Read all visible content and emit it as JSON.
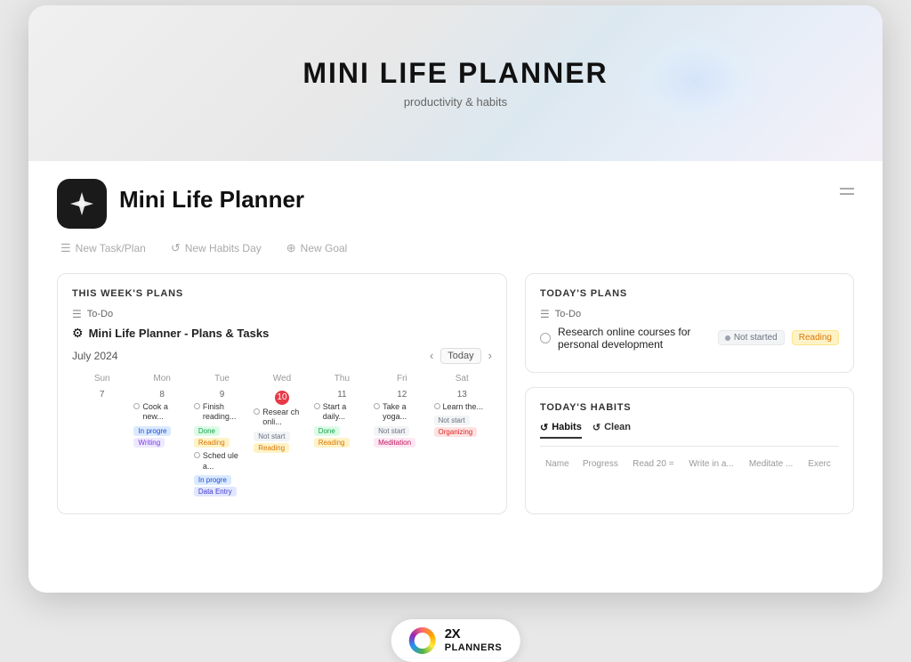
{
  "app": {
    "title": "MINI LIFE PLANNER",
    "subtitle": "productivity & habits",
    "page_name": "Mini Life Planner"
  },
  "actions": [
    {
      "id": "new-task",
      "label": "New Task/Plan",
      "icon": "☰"
    },
    {
      "id": "new-habits",
      "label": "New Habits Day",
      "icon": "↺"
    },
    {
      "id": "new-goal",
      "label": "New Goal",
      "icon": "⊕"
    }
  ],
  "this_weeks_plans": {
    "title": "THIS WEEK'S PLANS",
    "todo_label": "To-Do",
    "planner_icon": "⚙",
    "planner_name": "Mini Life Planner - Plans & Tasks",
    "calendar_month": "July 2024",
    "today_label": "Today",
    "days_of_week": [
      "Sun",
      "Mon",
      "Tue",
      "Wed",
      "Thu",
      "Fri",
      "Sat"
    ],
    "week_dates": [
      7,
      8,
      9,
      10,
      11,
      12,
      13
    ],
    "today_date": 10,
    "tasks": {
      "7": [],
      "8": [
        {
          "text": "Cook a new...",
          "tag": "In progress",
          "tag_class": "tag-in-progress"
        },
        {
          "tag2": "Writing",
          "tag2_class": "tag-writing"
        }
      ],
      "9": [
        {
          "text": "Finish reading...",
          "tag": "Done",
          "tag_class": "tag-done"
        },
        {
          "tag2": "Reading",
          "tag2_class": "tag-reading"
        },
        {
          "text2": "Sched ule a...",
          "tag3": "In progre",
          "tag3_class": "tag-in-progress"
        },
        {
          "tag4": "Data Entry",
          "tag4_class": "tag-data-entry"
        }
      ],
      "10": [
        {
          "text": "Resear ch onli...",
          "tag": "Not start",
          "tag_class": "tag-not-started"
        },
        {
          "tag2": "Reading",
          "tag2_class": "tag-reading"
        }
      ],
      "11": [
        {
          "text": "Start a daily...",
          "tag": "Done",
          "tag_class": "tag-done"
        },
        {
          "tag2": "Reading",
          "tag2_class": "tag-reading"
        }
      ],
      "12": [
        {
          "text": "Take a yoga...",
          "tag": "Not start",
          "tag_class": "tag-not-started"
        },
        {
          "tag2": "Meditation",
          "tag2_class": "tag-meditation"
        }
      ],
      "13": [
        {
          "text": "Learn the...",
          "tag": "Not start",
          "tag_class": "tag-not-started"
        },
        {
          "tag2": "Organizing",
          "tag2_class": "tag-organizing"
        }
      ]
    }
  },
  "todays_plans": {
    "title": "TODAY'S PLANS",
    "todo_label": "To-Do",
    "tasks": [
      {
        "text": "Research online courses for personal development",
        "status": "Not started",
        "status_class": "status-not-started",
        "category": "Reading",
        "category_class": "status-reading"
      }
    ]
  },
  "todays_habits": {
    "title": "TODAY'S HABITS",
    "tabs": [
      {
        "label": "Habits",
        "icon": "↺",
        "active": true
      },
      {
        "label": "Clean",
        "icon": "↺",
        "active": false
      }
    ],
    "columns": [
      "Name",
      "Progress",
      "Read 20 =",
      "Write in a...",
      "Meditate ...",
      "Exerc"
    ],
    "rows": []
  },
  "bottom_badge": {
    "number": "2X",
    "name": "PLANNERS"
  }
}
